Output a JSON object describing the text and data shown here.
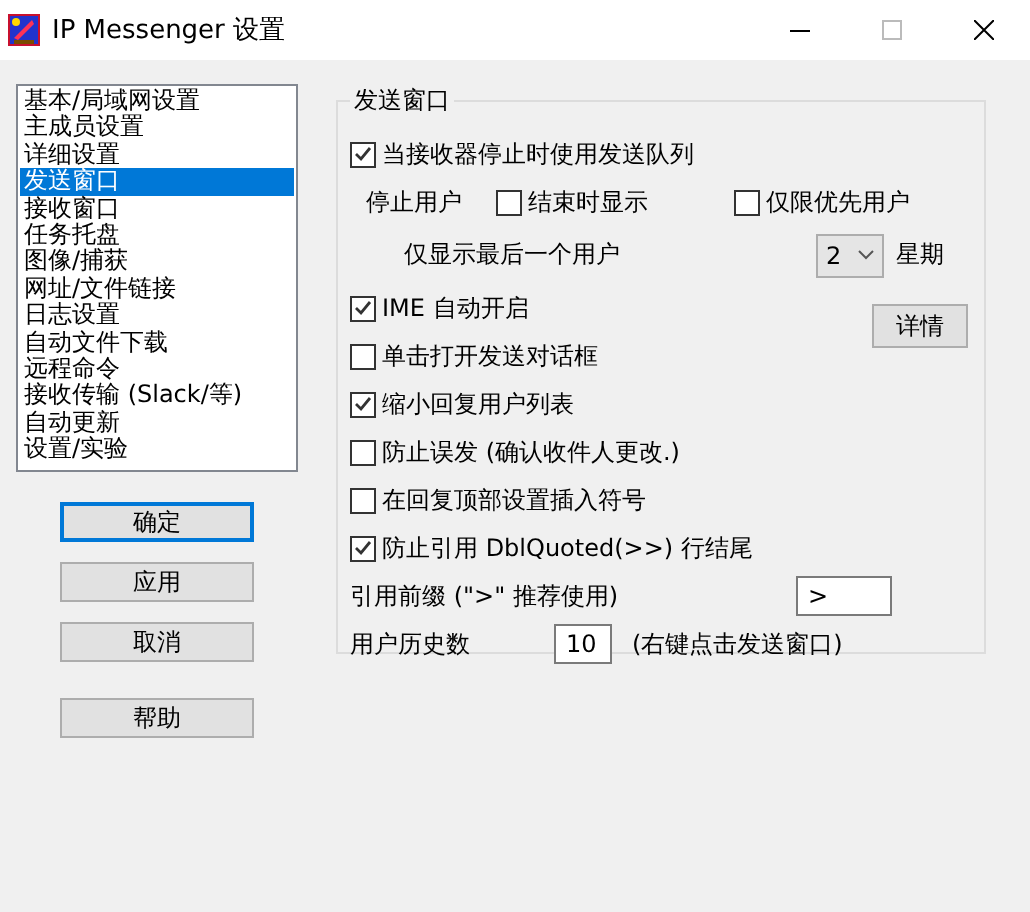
{
  "window": {
    "title": "IP Messenger 设置"
  },
  "sidebar": {
    "items": [
      {
        "label": "基本/局域网设置",
        "selected": false
      },
      {
        "label": "主成员设置",
        "selected": false
      },
      {
        "label": "详细设置",
        "selected": false
      },
      {
        "label": "发送窗口",
        "selected": true
      },
      {
        "label": "接收窗口",
        "selected": false
      },
      {
        "label": "任务托盘",
        "selected": false
      },
      {
        "label": "图像/捕获",
        "selected": false
      },
      {
        "label": "网址/文件链接",
        "selected": false
      },
      {
        "label": "日志设置",
        "selected": false
      },
      {
        "label": "自动文件下载",
        "selected": false
      },
      {
        "label": "远程命令",
        "selected": false
      },
      {
        "label": "接收传输 (Slack/等)",
        "selected": false
      },
      {
        "label": "自动更新",
        "selected": false
      },
      {
        "label": "设置/实验",
        "selected": false
      }
    ]
  },
  "buttons": [
    {
      "label": "确定",
      "default": true
    },
    {
      "label": "应用",
      "default": false
    },
    {
      "label": "取消",
      "default": false
    }
  ],
  "help_button": {
    "label": "帮助"
  },
  "group": {
    "title": "发送窗口",
    "rows": [
      {
        "kind": "checkbox",
        "label": "当接收器停止时使用发送队列",
        "checked": true
      },
      {
        "kind": "options",
        "label": "停止用户",
        "options": [
          {
            "label": "结束时显示",
            "checked": false
          },
          {
            "label": "仅限优先用户",
            "checked": false
          }
        ]
      },
      {
        "kind": "select",
        "label": "仅显示最后一个用户",
        "value": "2",
        "suffix": "星期"
      },
      {
        "kind": "checkbox",
        "label": "IME 自动开启",
        "checked": true,
        "button": "详情"
      },
      {
        "kind": "checkbox",
        "label": "单击打开发送对话框",
        "checked": false
      },
      {
        "kind": "checkbox",
        "label": "缩小回复用户列表",
        "checked": true
      },
      {
        "kind": "checkbox",
        "label": "防止误发 (确认收件人更改.)",
        "checked": false
      },
      {
        "kind": "checkbox",
        "label": "在回复顶部设置插入符号",
        "checked": false
      },
      {
        "kind": "checkbox",
        "label": "防止引用 DblQuoted(>>) 行结尾",
        "checked": true
      },
      {
        "kind": "input",
        "label": "引用前缀 (\">\" 推荐使用)",
        "value": ">"
      },
      {
        "kind": "input",
        "label": "用户历史数",
        "value": "10",
        "note": "(右键点击发送窗口)"
      }
    ]
  }
}
